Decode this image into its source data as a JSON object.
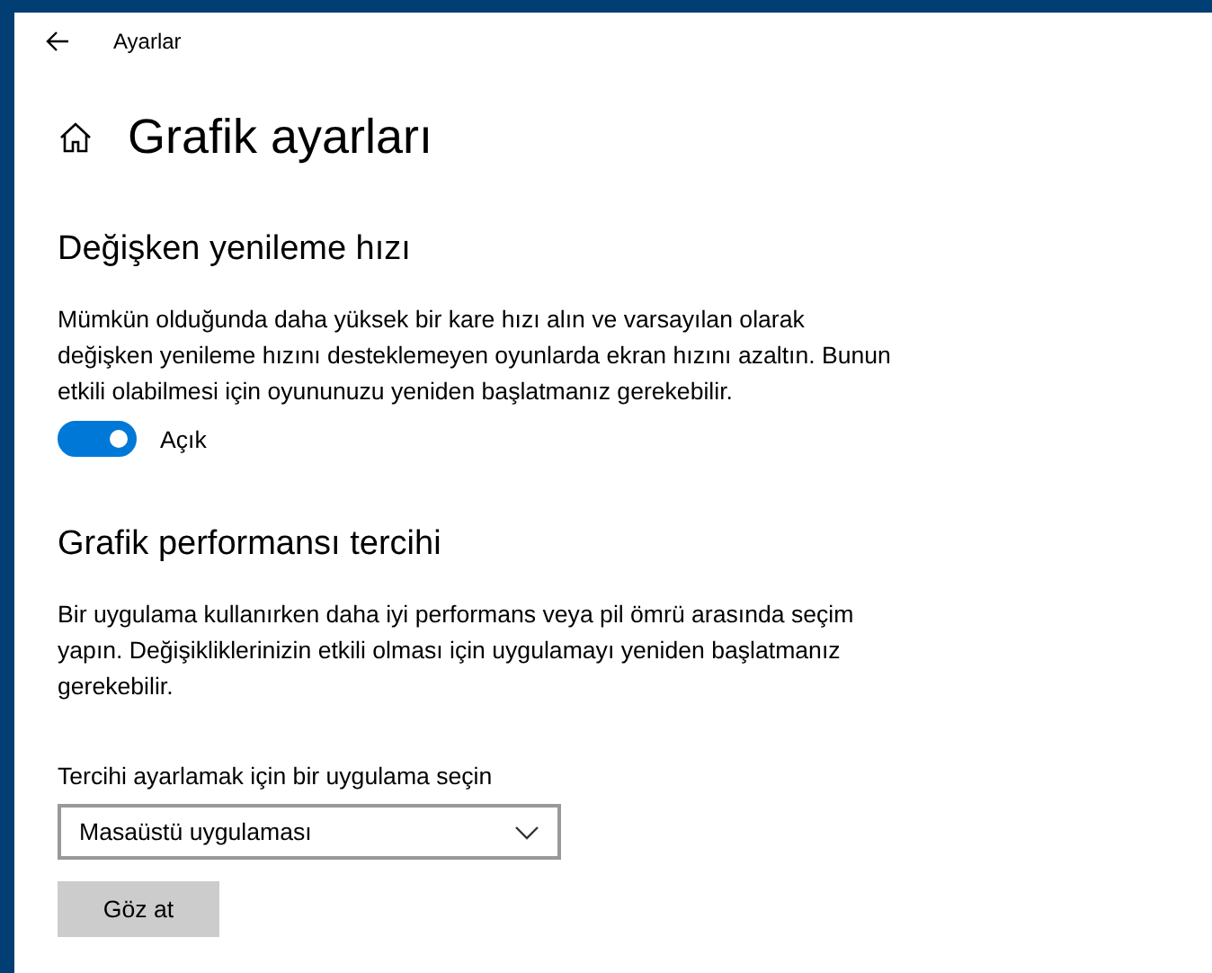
{
  "window": {
    "title": "Ayarlar"
  },
  "page_title": "Grafik ayarları",
  "sections": [
    {
      "kind": "toggle",
      "heading": "Değişken yenileme hızı",
      "description": "Mümkün olduğunda daha yüksek bir kare hızı alın ve varsayılan olarak değişken yenileme hızını desteklemeyen oyunlarda ekran hızını azaltın. Bunun etkili olabilmesi için oyununuzu yeniden başlatmanız gerekebilir.",
      "toggle": {
        "on": true,
        "label": "Açık"
      }
    },
    {
      "kind": "picker",
      "heading": "Grafik performansı tercihi",
      "description": "Bir uygulama kullanırken daha iyi performans veya pil ömrü arasında seçim yapın. Değişikliklerinizin etkili olması için uygulamayı yeniden başlatmanız gerekebilir.",
      "field_label": "Tercihi ayarlamak için bir uygulama seçin",
      "dropdown": {
        "value": "Masaüstü uygulaması"
      },
      "button": "Göz at"
    }
  ]
}
